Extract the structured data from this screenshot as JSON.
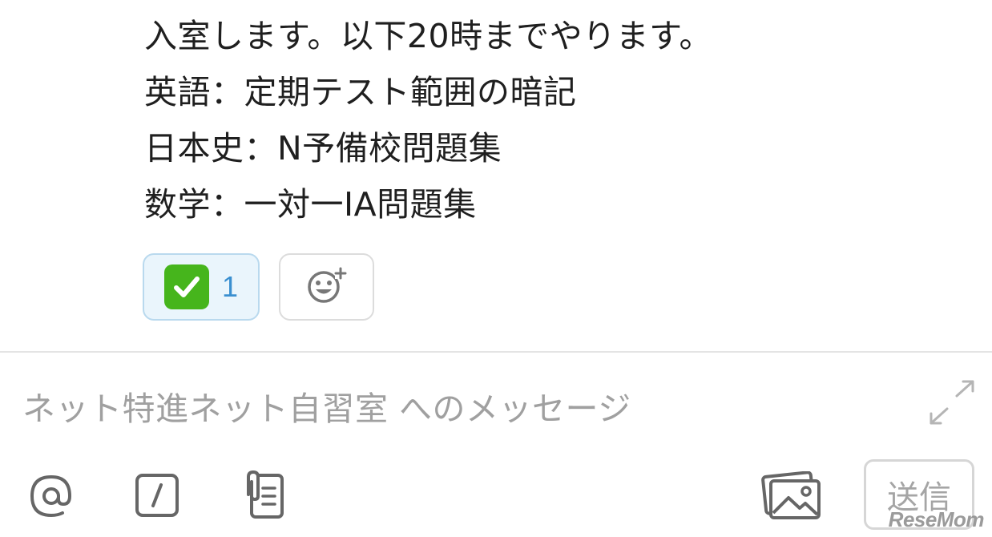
{
  "message": {
    "lines": [
      "入室します。以下20時までやります。",
      "英語：定期テスト範囲の暗記",
      "日本史：N予備校問題集",
      "数学：一対一IA問題集"
    ]
  },
  "reactions": {
    "check": {
      "emoji": "check-mark-button-emoji",
      "count": "1"
    },
    "add": {
      "icon": "add-reaction-icon"
    }
  },
  "composer": {
    "placeholder": "ネット特進ネット自習室 へのメッセージ",
    "send_label": "送信",
    "icons": [
      "at-mention-icon",
      "slash-command-icon",
      "attach-file-icon",
      "photo-icon",
      "expand-icon"
    ]
  },
  "watermark": "ReseMom",
  "colors": {
    "reaction_bg": "#eaf5fc",
    "reaction_border": "#b9d9ee",
    "reaction_count": "#3a8fd0",
    "check_green": "#46b51c",
    "placeholder_gray": "#a0a0a0",
    "icon_gray": "#666666"
  }
}
